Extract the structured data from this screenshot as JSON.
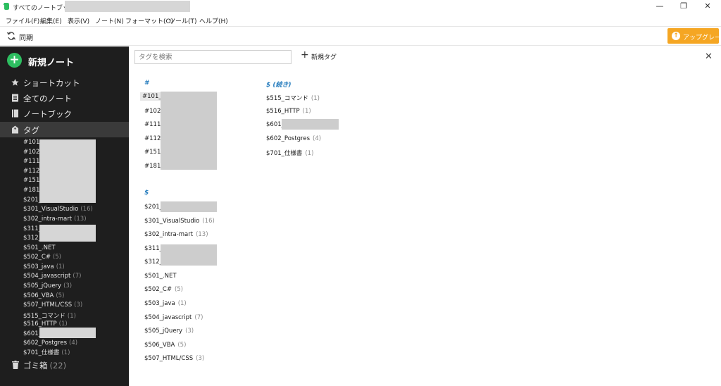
{
  "window": {
    "title": "すべてのノートブック -",
    "minimize": "—",
    "restore": "❐",
    "close": "✕"
  },
  "menu": [
    "ファイル(F)",
    "編集(E)",
    "表示(V)",
    "ノート(N)",
    "フォーマット(O)",
    "ツール(T)",
    "ヘルプ(H)"
  ],
  "toolbar": {
    "sync_label": "同期",
    "upgrade_label": "アップグレード",
    "accent": "#f5a623"
  },
  "sidebar": {
    "new_note_label": "新規ノート",
    "nav": [
      {
        "label": "ショートカット",
        "icon": "star-icon"
      },
      {
        "label": "全てのノート",
        "icon": "note-icon"
      },
      {
        "label": "ノートブック",
        "icon": "notebook-icon"
      },
      {
        "label": "タグ",
        "icon": "tag-icon"
      }
    ],
    "tags": [
      {
        "name": "#101_",
        "count": ""
      },
      {
        "name": "#102_",
        "count": ""
      },
      {
        "name": "#111_",
        "count": ""
      },
      {
        "name": "#112_",
        "count": ""
      },
      {
        "name": "#151_",
        "count": ""
      },
      {
        "name": "#181_",
        "count": ""
      },
      {
        "name": "$201_",
        "count": ""
      },
      {
        "name": "$301_VisualStudio",
        "count": "(16)"
      },
      {
        "name": "$302_intra-mart",
        "count": "(13)"
      },
      {
        "name": "$311_",
        "count": ""
      },
      {
        "name": "$312_",
        "count": ""
      },
      {
        "name": "$501_.NET",
        "count": ""
      },
      {
        "name": "$502_C#",
        "count": "(5)"
      },
      {
        "name": "$503_java",
        "count": "(1)"
      },
      {
        "name": "$504_javascript",
        "count": "(7)"
      },
      {
        "name": "$505_jQuery",
        "count": "(3)"
      },
      {
        "name": "$506_VBA",
        "count": "(5)"
      },
      {
        "name": "$507_HTML/CSS",
        "count": "(3)"
      },
      {
        "name": "$515_コマンド",
        "count": "(1)"
      },
      {
        "name": "$516_HTTP",
        "count": "(1)"
      },
      {
        "name": "$601_",
        "count": ""
      },
      {
        "name": "$602_Postgres",
        "count": "(4)"
      },
      {
        "name": "$701_仕様書",
        "count": "(1)"
      }
    ],
    "trash_label": "ゴミ箱",
    "trash_count": "(22)",
    "brand": "#2dbe60"
  },
  "main": {
    "search_placeholder": "タグを検索",
    "new_tag_label": "新規タグ",
    "close": "✕",
    "col1": {
      "hash_head": "#",
      "hash_tags": [
        {
          "name": "#101_",
          "count": ""
        },
        {
          "name": "#102_",
          "count": ""
        },
        {
          "name": "#111_",
          "count": ""
        },
        {
          "name": "#112_",
          "count": ""
        },
        {
          "name": "#151_",
          "count": ""
        },
        {
          "name": "#181_",
          "count": ""
        }
      ],
      "dollar_head": "$",
      "dollar_tags": [
        {
          "name": "$201_",
          "count": ""
        },
        {
          "name": "$301_VisualStudio",
          "count": "(16)"
        },
        {
          "name": "$302_intra-mart",
          "count": "(13)"
        },
        {
          "name": "$311_",
          "count": ""
        },
        {
          "name": "$312_",
          "count": ""
        },
        {
          "name": "$501_.NET",
          "count": ""
        },
        {
          "name": "$502_C#",
          "count": "(5)"
        },
        {
          "name": "$503_java",
          "count": "(1)"
        },
        {
          "name": "$504_javascript",
          "count": "(7)"
        },
        {
          "name": "$505_jQuery",
          "count": "(3)"
        },
        {
          "name": "$506_VBA",
          "count": "(5)"
        },
        {
          "name": "$507_HTML/CSS",
          "count": "(3)"
        }
      ]
    },
    "col2": {
      "head": "$ (続き)",
      "tags": [
        {
          "name": "$515_コマンド",
          "count": "(1)"
        },
        {
          "name": "$516_HTTP",
          "count": "(1)"
        },
        {
          "name": "$601_",
          "count": ""
        },
        {
          "name": "$602_Postgres",
          "count": "(4)"
        },
        {
          "name": "$701_仕様書",
          "count": "(1)"
        }
      ]
    }
  }
}
